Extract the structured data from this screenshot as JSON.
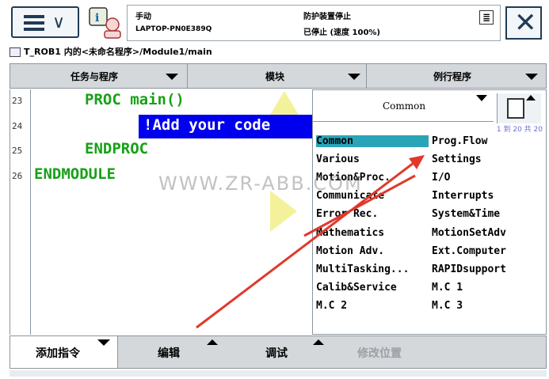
{
  "header": {
    "mode": "手动",
    "hostname": "LAPTOP-PN0E389Q",
    "guard_status": "防护装置停止",
    "run_status": "已停止 (速度 100%)",
    "status_icon": "≣",
    "close_icon": "✕",
    "menu_chevron": "∨"
  },
  "breadcrumb": "T_ROB1 内的<未命名程序>/Module1/main",
  "tabs": [
    {
      "label": "任务与程序"
    },
    {
      "label": "模块"
    },
    {
      "label": "例行程序"
    }
  ],
  "code": {
    "line_numbers": [
      "23",
      "24",
      "25",
      "26"
    ],
    "lines": [
      "PROC main()",
      "!Add your code",
      "ENDPROC",
      "ENDMODULE"
    ]
  },
  "watermark": "WWW.ZR-ABB.COM",
  "panel": {
    "category": "Common",
    "pager": "1 到 20 共 20",
    "items_left": [
      "Common",
      "Various",
      "Motion&Proc.",
      "Communicate",
      "Error Rec.",
      "Mathematics",
      "Motion Adv.",
      "MultiTasking...",
      "Calib&Service",
      "M.C 2"
    ],
    "items_right": [
      "Prog.Flow",
      "Settings",
      "I/O",
      "Interrupts",
      "System&Time",
      "MotionSetAdv",
      "Ext.Computer",
      "RAPIDsupport",
      "M.C 1",
      "M.C 3"
    ],
    "selected": "Common"
  },
  "bottom": {
    "add_instruction": "添加指令",
    "edit": "编辑",
    "debug": "调试",
    "modify_position": "修改位置"
  },
  "colors": {
    "code_green": "#17a117",
    "selection_blue": "#0000ee",
    "list_selection": "#2aa5b8",
    "annotation_red": "#e0392b"
  }
}
